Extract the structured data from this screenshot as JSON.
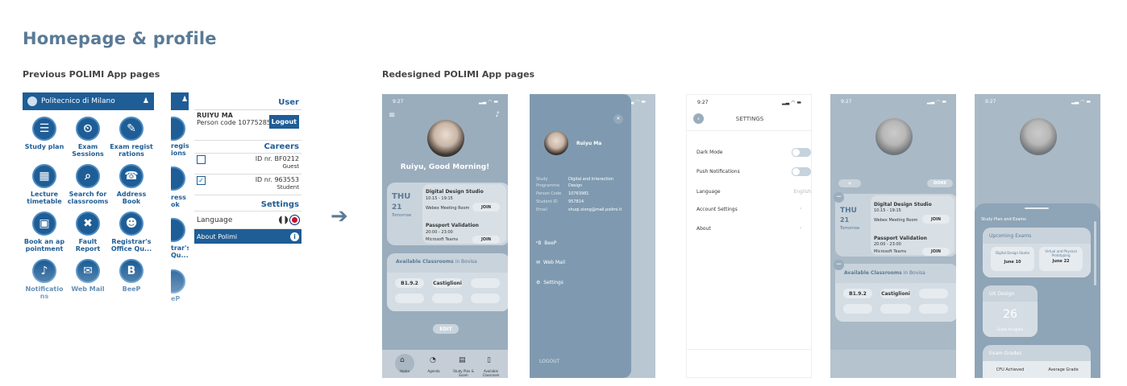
{
  "title": "Homepage & profile",
  "sub_prev": "Previous POLIMI App pages",
  "sub_new": "Redesigned POLIMI App pages",
  "old1": {
    "app_title": "Politecnico di Milano",
    "items": [
      {
        "label": "Study plan",
        "icon": "list-icon",
        "glyph": "☰"
      },
      {
        "label": "Exam Sessions",
        "icon": "clock-user-icon",
        "glyph": "⏲"
      },
      {
        "label": "Exam regist rations",
        "icon": "pencil-icon",
        "glyph": "✎"
      },
      {
        "label": "Lecture timetable",
        "icon": "calendar-icon",
        "glyph": "▦"
      },
      {
        "label": "Search for classrooms",
        "icon": "classroom-icon",
        "glyph": "⌕"
      },
      {
        "label": "Address Book",
        "icon": "phone-icon",
        "glyph": "☎"
      },
      {
        "label": "Book an ap pointment",
        "icon": "book-icon",
        "glyph": "▣"
      },
      {
        "label": "Fault Report",
        "icon": "tools-icon",
        "glyph": "✖"
      },
      {
        "label": "Registrar's Office Qu...",
        "icon": "people-icon",
        "glyph": "☻"
      },
      {
        "label": "Notificatio ns",
        "icon": "bell-icon",
        "glyph": "♪"
      },
      {
        "label": "Web Mail",
        "icon": "mail-icon",
        "glyph": "✉"
      },
      {
        "label": "BeeP",
        "icon": "beep-icon",
        "glyph": "B"
      }
    ]
  },
  "old2": {
    "strip": [
      "regist",
      "ions",
      "ress",
      "ok",
      "trar's",
      "Qu...",
      "eP"
    ],
    "user_header": "User",
    "name": "RUIYU MA",
    "person_code": "Person code 10775285",
    "logout": "Logout",
    "careers_header": "Careers",
    "careers": [
      {
        "id": "ID nr. BF0212",
        "role": "Guest"
      },
      {
        "id": "ID nr. 963553",
        "role": "Student"
      }
    ],
    "settings_header": "Settings",
    "language": "Language",
    "about": "About Polimi"
  },
  "time": "9:27",
  "p1": {
    "greet": "Ruiyu, Good Morning!",
    "day": "THU",
    "date": "21",
    "when": "Tomorrow",
    "ev1": "Digital Design Studio",
    "ev1t": "10:15 - 19:15",
    "ev1r": "Webex Meeting Room",
    "join": "JOIN",
    "ev2": "Passport Validation",
    "ev2t": "20:00 - 23:00",
    "ev2r": "Microsoft Teams",
    "avail": "Available Classrooms",
    "in": "in Bovisa",
    "rooms": [
      "B1.9.2",
      "Castiglioni"
    ],
    "edit": "EDIT",
    "tabs": [
      "Home",
      "Agenda",
      "Study Plan & Exam",
      "Available Classroom"
    ]
  },
  "p2": {
    "name": "Ruiyu  Ma",
    "k1": "Study Programme",
    "v1": "Digital and Interaction Design",
    "k2": "Person Code",
    "v2": "10763981",
    "k3": "Student ID",
    "v3": "957814",
    "k4": "Email",
    "v4": "shuqi.xiong@mail.polimi.it",
    "m1": "BeeP",
    "m2": "Web Mail",
    "m3": "Settings",
    "logout": "LOGOUT"
  },
  "p3": {
    "header": "SETTINGS",
    "r1": "Dark Mode",
    "r2": "Push Notifications",
    "r3": "Language",
    "r3v": "English",
    "r4": "Account Settings",
    "r5": "About"
  },
  "p4": {
    "done": "DONE"
  },
  "p5": {
    "sheet": "Study Plan and Exams",
    "upcoming": "Upcoming Exams",
    "e1": "Digital Design Studio",
    "e1d": "June 10",
    "e2": "Virtual and Physical Prototyping",
    "e2d": "June 22",
    "ux": "UX Design",
    "uxn": "26",
    "uxs": "Grade Accepted",
    "grades": "Exam Grades",
    "cfu": "CFU Achieved",
    "avg": "Average Grade"
  }
}
